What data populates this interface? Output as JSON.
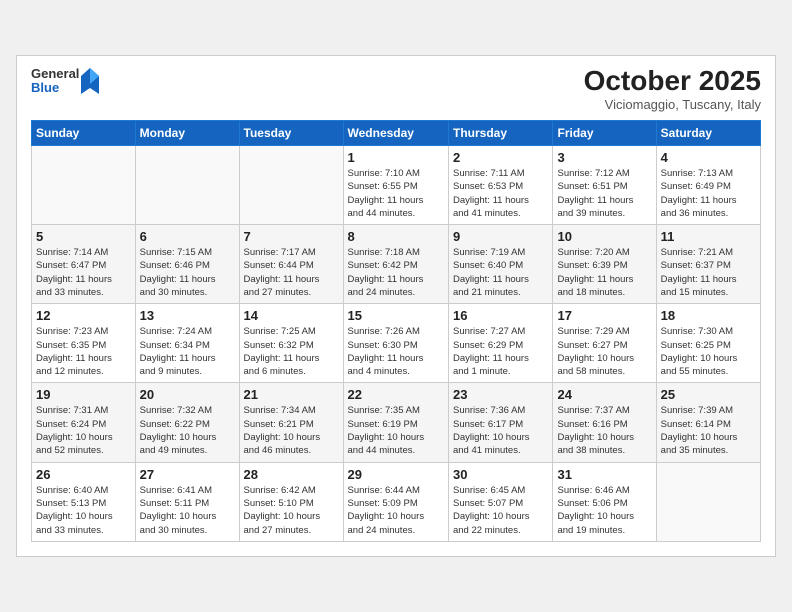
{
  "header": {
    "logo_general": "General",
    "logo_blue": "Blue",
    "month_title": "October 2025",
    "subtitle": "Viciomaggio, Tuscany, Italy"
  },
  "weekdays": [
    "Sunday",
    "Monday",
    "Tuesday",
    "Wednesday",
    "Thursday",
    "Friday",
    "Saturday"
  ],
  "weeks": [
    [
      {
        "day": "",
        "info": ""
      },
      {
        "day": "",
        "info": ""
      },
      {
        "day": "",
        "info": ""
      },
      {
        "day": "1",
        "info": "Sunrise: 7:10 AM\nSunset: 6:55 PM\nDaylight: 11 hours\nand 44 minutes."
      },
      {
        "day": "2",
        "info": "Sunrise: 7:11 AM\nSunset: 6:53 PM\nDaylight: 11 hours\nand 41 minutes."
      },
      {
        "day": "3",
        "info": "Sunrise: 7:12 AM\nSunset: 6:51 PM\nDaylight: 11 hours\nand 39 minutes."
      },
      {
        "day": "4",
        "info": "Sunrise: 7:13 AM\nSunset: 6:49 PM\nDaylight: 11 hours\nand 36 minutes."
      }
    ],
    [
      {
        "day": "5",
        "info": "Sunrise: 7:14 AM\nSunset: 6:47 PM\nDaylight: 11 hours\nand 33 minutes."
      },
      {
        "day": "6",
        "info": "Sunrise: 7:15 AM\nSunset: 6:46 PM\nDaylight: 11 hours\nand 30 minutes."
      },
      {
        "day": "7",
        "info": "Sunrise: 7:17 AM\nSunset: 6:44 PM\nDaylight: 11 hours\nand 27 minutes."
      },
      {
        "day": "8",
        "info": "Sunrise: 7:18 AM\nSunset: 6:42 PM\nDaylight: 11 hours\nand 24 minutes."
      },
      {
        "day": "9",
        "info": "Sunrise: 7:19 AM\nSunset: 6:40 PM\nDaylight: 11 hours\nand 21 minutes."
      },
      {
        "day": "10",
        "info": "Sunrise: 7:20 AM\nSunset: 6:39 PM\nDaylight: 11 hours\nand 18 minutes."
      },
      {
        "day": "11",
        "info": "Sunrise: 7:21 AM\nSunset: 6:37 PM\nDaylight: 11 hours\nand 15 minutes."
      }
    ],
    [
      {
        "day": "12",
        "info": "Sunrise: 7:23 AM\nSunset: 6:35 PM\nDaylight: 11 hours\nand 12 minutes."
      },
      {
        "day": "13",
        "info": "Sunrise: 7:24 AM\nSunset: 6:34 PM\nDaylight: 11 hours\nand 9 minutes."
      },
      {
        "day": "14",
        "info": "Sunrise: 7:25 AM\nSunset: 6:32 PM\nDaylight: 11 hours\nand 6 minutes."
      },
      {
        "day": "15",
        "info": "Sunrise: 7:26 AM\nSunset: 6:30 PM\nDaylight: 11 hours\nand 4 minutes."
      },
      {
        "day": "16",
        "info": "Sunrise: 7:27 AM\nSunset: 6:29 PM\nDaylight: 11 hours\nand 1 minute."
      },
      {
        "day": "17",
        "info": "Sunrise: 7:29 AM\nSunset: 6:27 PM\nDaylight: 10 hours\nand 58 minutes."
      },
      {
        "day": "18",
        "info": "Sunrise: 7:30 AM\nSunset: 6:25 PM\nDaylight: 10 hours\nand 55 minutes."
      }
    ],
    [
      {
        "day": "19",
        "info": "Sunrise: 7:31 AM\nSunset: 6:24 PM\nDaylight: 10 hours\nand 52 minutes."
      },
      {
        "day": "20",
        "info": "Sunrise: 7:32 AM\nSunset: 6:22 PM\nDaylight: 10 hours\nand 49 minutes."
      },
      {
        "day": "21",
        "info": "Sunrise: 7:34 AM\nSunset: 6:21 PM\nDaylight: 10 hours\nand 46 minutes."
      },
      {
        "day": "22",
        "info": "Sunrise: 7:35 AM\nSunset: 6:19 PM\nDaylight: 10 hours\nand 44 minutes."
      },
      {
        "day": "23",
        "info": "Sunrise: 7:36 AM\nSunset: 6:17 PM\nDaylight: 10 hours\nand 41 minutes."
      },
      {
        "day": "24",
        "info": "Sunrise: 7:37 AM\nSunset: 6:16 PM\nDaylight: 10 hours\nand 38 minutes."
      },
      {
        "day": "25",
        "info": "Sunrise: 7:39 AM\nSunset: 6:14 PM\nDaylight: 10 hours\nand 35 minutes."
      }
    ],
    [
      {
        "day": "26",
        "info": "Sunrise: 6:40 AM\nSunset: 5:13 PM\nDaylight: 10 hours\nand 33 minutes."
      },
      {
        "day": "27",
        "info": "Sunrise: 6:41 AM\nSunset: 5:11 PM\nDaylight: 10 hours\nand 30 minutes."
      },
      {
        "day": "28",
        "info": "Sunrise: 6:42 AM\nSunset: 5:10 PM\nDaylight: 10 hours\nand 27 minutes."
      },
      {
        "day": "29",
        "info": "Sunrise: 6:44 AM\nSunset: 5:09 PM\nDaylight: 10 hours\nand 24 minutes."
      },
      {
        "day": "30",
        "info": "Sunrise: 6:45 AM\nSunset: 5:07 PM\nDaylight: 10 hours\nand 22 minutes."
      },
      {
        "day": "31",
        "info": "Sunrise: 6:46 AM\nSunset: 5:06 PM\nDaylight: 10 hours\nand 19 minutes."
      },
      {
        "day": "",
        "info": ""
      }
    ]
  ]
}
